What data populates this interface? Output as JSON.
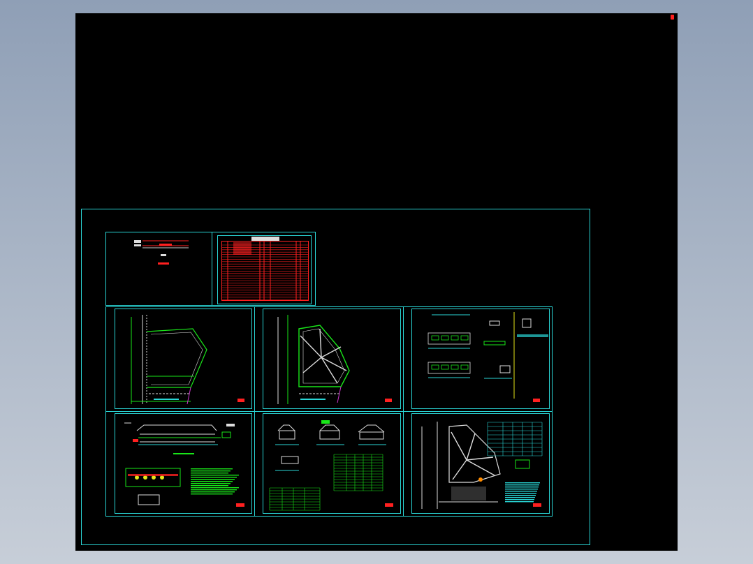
{
  "app": {
    "background_color": "#000000",
    "accent_cyan": "#2ad6d6",
    "accent_green": "#19e619",
    "accent_red": "#ff2020"
  },
  "sheets": [
    {
      "id": "cover",
      "label": ""
    },
    {
      "id": "index",
      "label": ""
    },
    {
      "id": "plan-1",
      "label": ""
    },
    {
      "id": "plan-2",
      "label": ""
    },
    {
      "id": "sections-1",
      "label": ""
    },
    {
      "id": "section-long",
      "label": ""
    },
    {
      "id": "details",
      "label": ""
    },
    {
      "id": "plan-3",
      "label": ""
    }
  ]
}
